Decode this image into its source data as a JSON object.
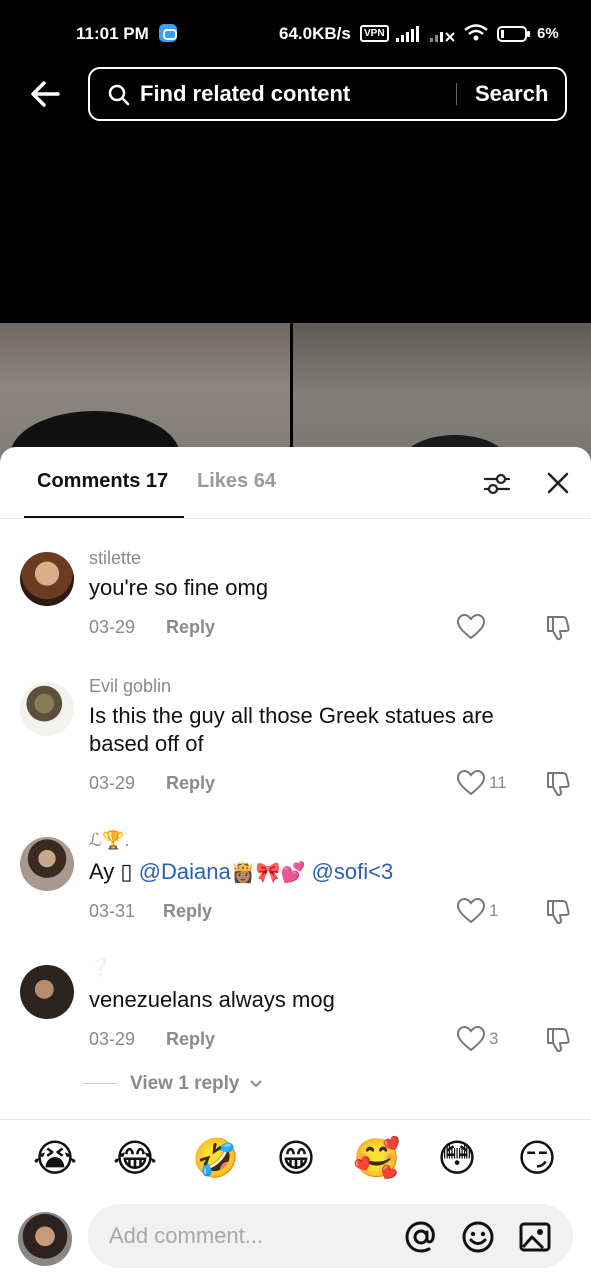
{
  "status_bar": {
    "time": "11:01 PM",
    "network_speed": "64.0KB/s",
    "vpn": "VPN",
    "battery": "6%"
  },
  "search": {
    "placeholder": "Find related content",
    "button_label": "Search"
  },
  "comments_panel": {
    "tab_comments": "Comments 17",
    "tab_likes": "Likes 64",
    "comments": [
      {
        "username": "stilette",
        "text": "you're so fine omg",
        "date": "03-29",
        "reply_label": "Reply",
        "like_count": ""
      },
      {
        "username": "Evil goblin",
        "text": "Is this the guy all those Greek statues are based off of",
        "date": "03-29",
        "reply_label": "Reply",
        "like_count": "11"
      },
      {
        "username": "ℒ🏆.",
        "text_prefix": "Ay ▯",
        "mention_1": "@Daiana",
        "emojis": "👸🏽🎀💕",
        "mention_2": "@sofi<3",
        "date": "03-31",
        "reply_label": "Reply",
        "like_count": "1"
      },
      {
        "username": "❔",
        "text": "venezuelans always mog",
        "date": "03-29",
        "reply_label": "Reply",
        "like_count": "3"
      }
    ],
    "view_replies": "View 1 reply"
  },
  "emoji_bar": [
    "😭",
    "😂",
    "🤣",
    "😁",
    "🥰",
    "😳",
    "😏"
  ],
  "composer": {
    "placeholder": "Add comment..."
  },
  "colors": {
    "mention": "#2b5fb8",
    "muted_text": "#8a8a8a",
    "background_dark": "#000000",
    "sheet": "#ffffff"
  },
  "icons": [
    "back-arrow-icon",
    "search-icon",
    "filter-sliders-icon",
    "close-icon",
    "heart-icon",
    "dislike-icon",
    "chevron-down-icon",
    "at-icon",
    "smile-icon",
    "image-icon"
  ]
}
